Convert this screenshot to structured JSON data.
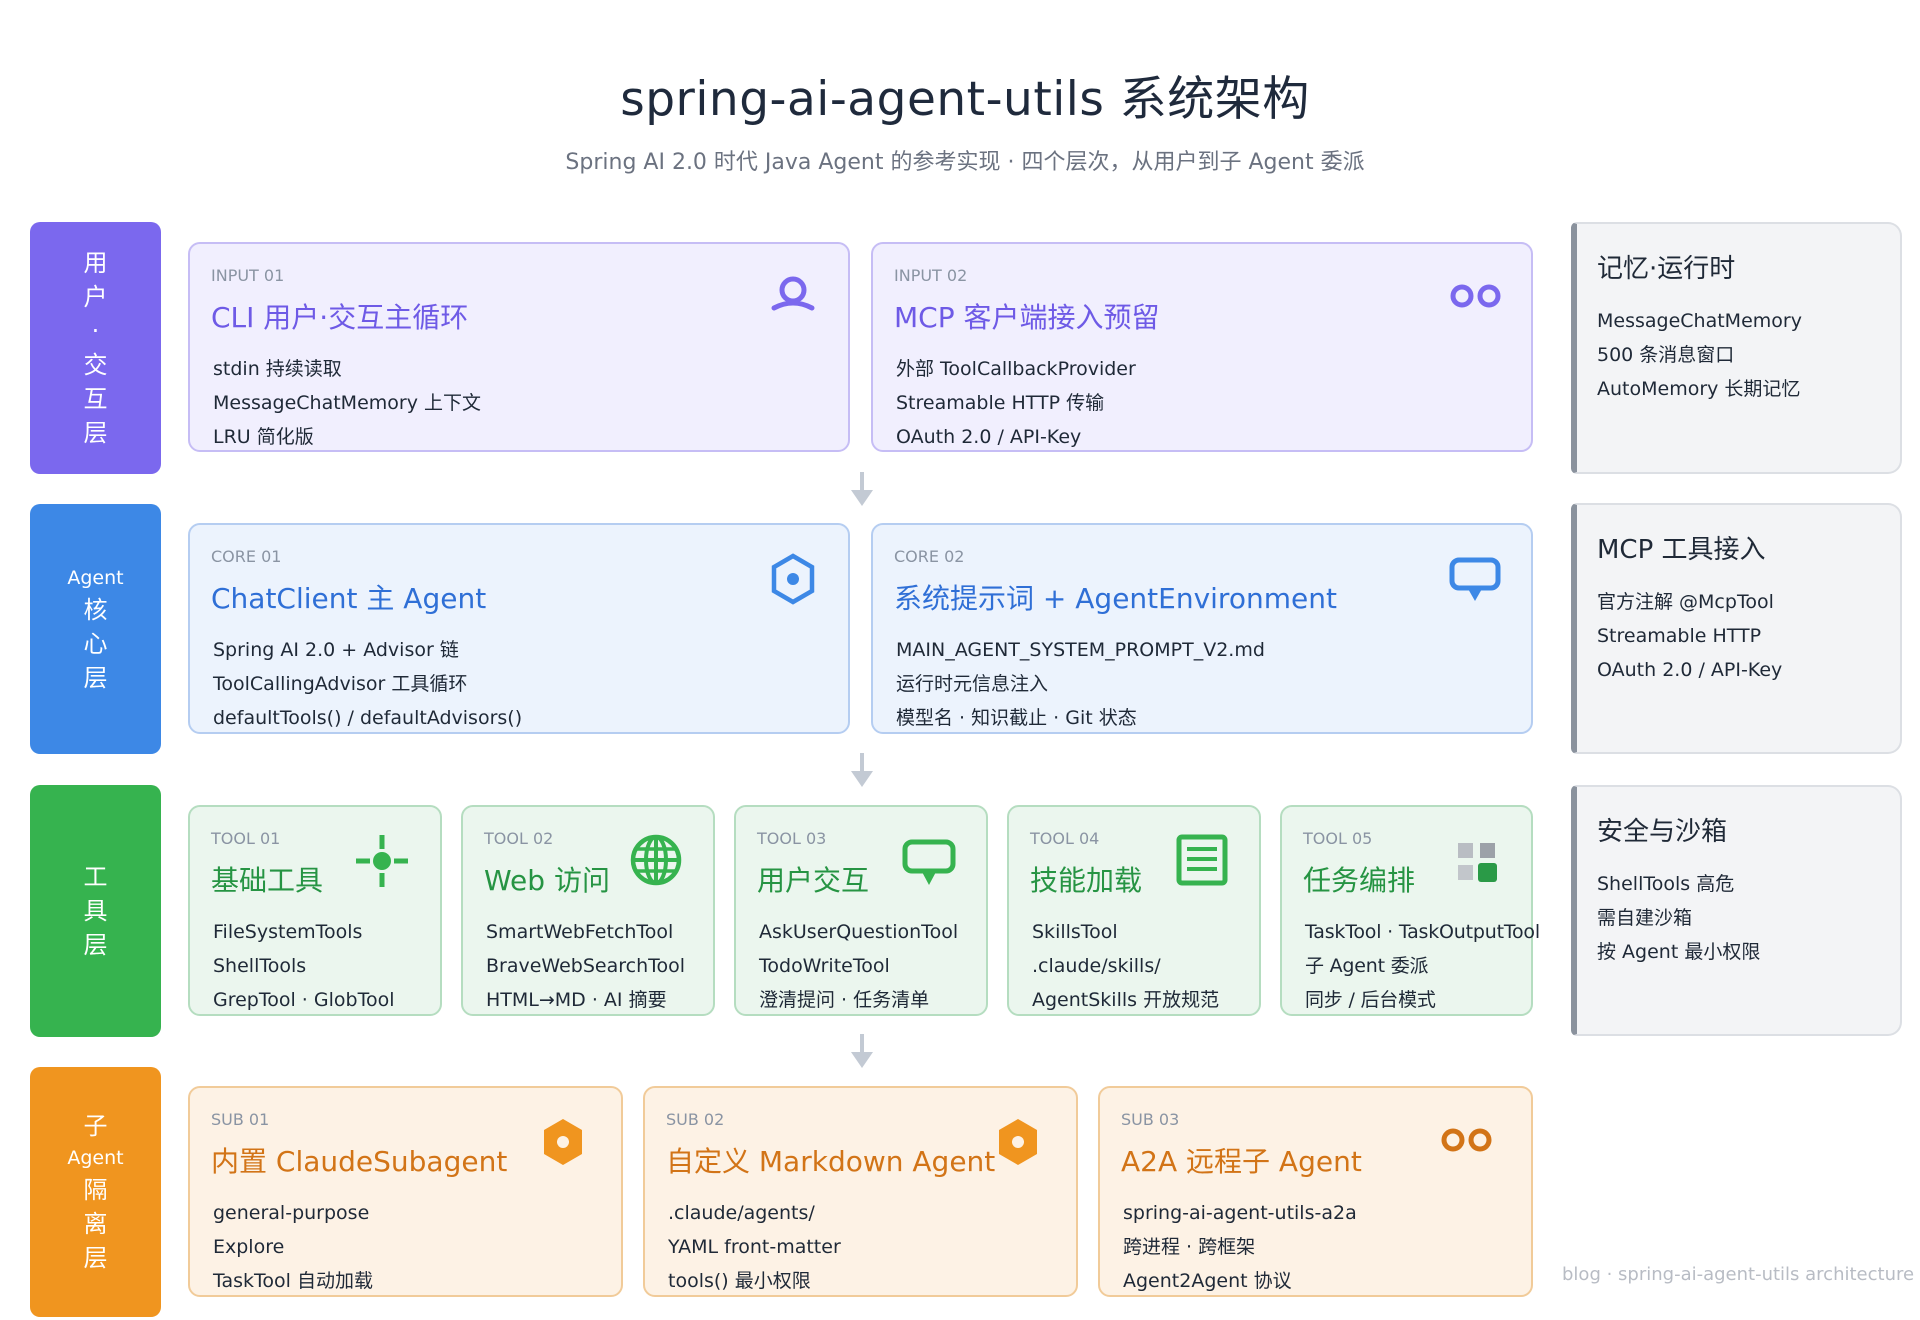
{
  "header": {
    "title": "spring-ai-agent-utils 系统架构",
    "subtitle": "Spring AI 2.0 时代 Java Agent 的参考实现 · 四个层次，从用户到子 Agent 委派"
  },
  "layers": [
    {
      "lines": [
        "用",
        "户",
        "·",
        "交",
        "互",
        "层"
      ],
      "color": "#7b68ee"
    },
    {
      "lines": [
        "Agent",
        "核",
        "心",
        "层"
      ],
      "color": "#3d88e6"
    },
    {
      "lines": [
        "工",
        "具",
        "层"
      ],
      "color": "#36b34f"
    },
    {
      "lines": [
        "子",
        "Agent",
        "隔",
        "离",
        "层"
      ],
      "color": "#f0951f"
    }
  ],
  "user_cards": [
    {
      "tag": "INPUT 01",
      "title": "CLI 用户·交互主循环",
      "icon": "user-search-icon",
      "lines": [
        "stdin 持续读取",
        "MessageChatMemory 上下文",
        "LRU 简化版"
      ]
    },
    {
      "tag": "INPUT 02",
      "title": "MCP 客户端接入预留",
      "icon": "double-ring-icon",
      "lines": [
        "外部 ToolCallbackProvider",
        "Streamable HTTP 传输",
        "OAuth 2.0 / API-Key"
      ]
    }
  ],
  "core_cards": [
    {
      "tag": "CORE 01",
      "title": "ChatClient 主 Agent",
      "icon": "hexagon-icon",
      "lines": [
        "Spring AI 2.0 + Advisor 链",
        "ToolCallingAdvisor 工具循环",
        "defaultTools() / defaultAdvisors()"
      ]
    },
    {
      "tag": "CORE 02",
      "title": "系统提示词 + AgentEnvironment",
      "icon": "chat-bubble-icon",
      "lines": [
        "MAIN_AGENT_SYSTEM_PROMPT_V2.md",
        "运行时元信息注入",
        "模型名 · 知识截止 · Git 状态"
      ]
    }
  ],
  "tool_cards": [
    {
      "tag": "TOOL 01",
      "title": "基础工具",
      "icon": "crosshair-icon",
      "lines": [
        "FileSystemTools",
        "ShellTools",
        "GrepTool · GlobTool"
      ]
    },
    {
      "tag": "TOOL 02",
      "title": "Web 访问",
      "icon": "globe-icon",
      "lines": [
        "SmartWebFetchTool",
        "BraveWebSearchTool",
        "HTML→MD · AI 摘要"
      ]
    },
    {
      "tag": "TOOL 03",
      "title": "用户交互",
      "icon": "chat-bubble-icon",
      "lines": [
        "AskUserQuestionTool",
        "TodoWriteTool",
        "澄清提问 · 任务清单"
      ]
    },
    {
      "tag": "TOOL 04",
      "title": "技能加载",
      "icon": "document-icon",
      "lines": [
        "SkillsTool",
        ".claude/skills/",
        "AgentSkills 开放规范"
      ]
    },
    {
      "tag": "TOOL 05",
      "title": "任务编排",
      "icon": "grid-icon",
      "lines": [
        "TaskTool · TaskOutputTool",
        "子 Agent 委派",
        "同步 / 后台模式"
      ]
    }
  ],
  "sub_cards": [
    {
      "tag": "SUB 01",
      "title": "内置 ClaudeSubagent",
      "icon": "hexagon-icon",
      "lines": [
        "general-purpose",
        "Explore",
        "TaskTool 自动加载"
      ]
    },
    {
      "tag": "SUB 02",
      "title": "自定义 Markdown Agent",
      "icon": "hexagon-icon",
      "lines": [
        ".claude/agents/",
        "YAML front-matter",
        "tools() 最小权限"
      ]
    },
    {
      "tag": "SUB 03",
      "title": "A2A 远程子 Agent",
      "icon": "double-ring-icon",
      "lines": [
        "spring-ai-agent-utils-a2a",
        "跨进程 · 跨框架",
        "Agent2Agent 协议"
      ]
    }
  ],
  "side_panels": [
    {
      "title": "记忆·运行时",
      "lines": [
        "MessageChatMemory",
        "500 条消息窗口",
        "AutoMemory 长期记忆"
      ]
    },
    {
      "title": "MCP 工具接入",
      "lines": [
        "官方注解 @McpTool",
        "Streamable HTTP",
        "OAuth 2.0 / API-Key"
      ]
    },
    {
      "title": "安全与沙箱",
      "lines": [
        "ShellTools 高危",
        "需自建沙箱",
        "按 Agent 最小权限"
      ]
    }
  ],
  "footer": "blog · spring-ai-agent-utils architecture",
  "colors": {
    "user": "#7b68ee",
    "core": "#3d88e6",
    "tool": "#36b34f",
    "sub": "#f0951f"
  }
}
